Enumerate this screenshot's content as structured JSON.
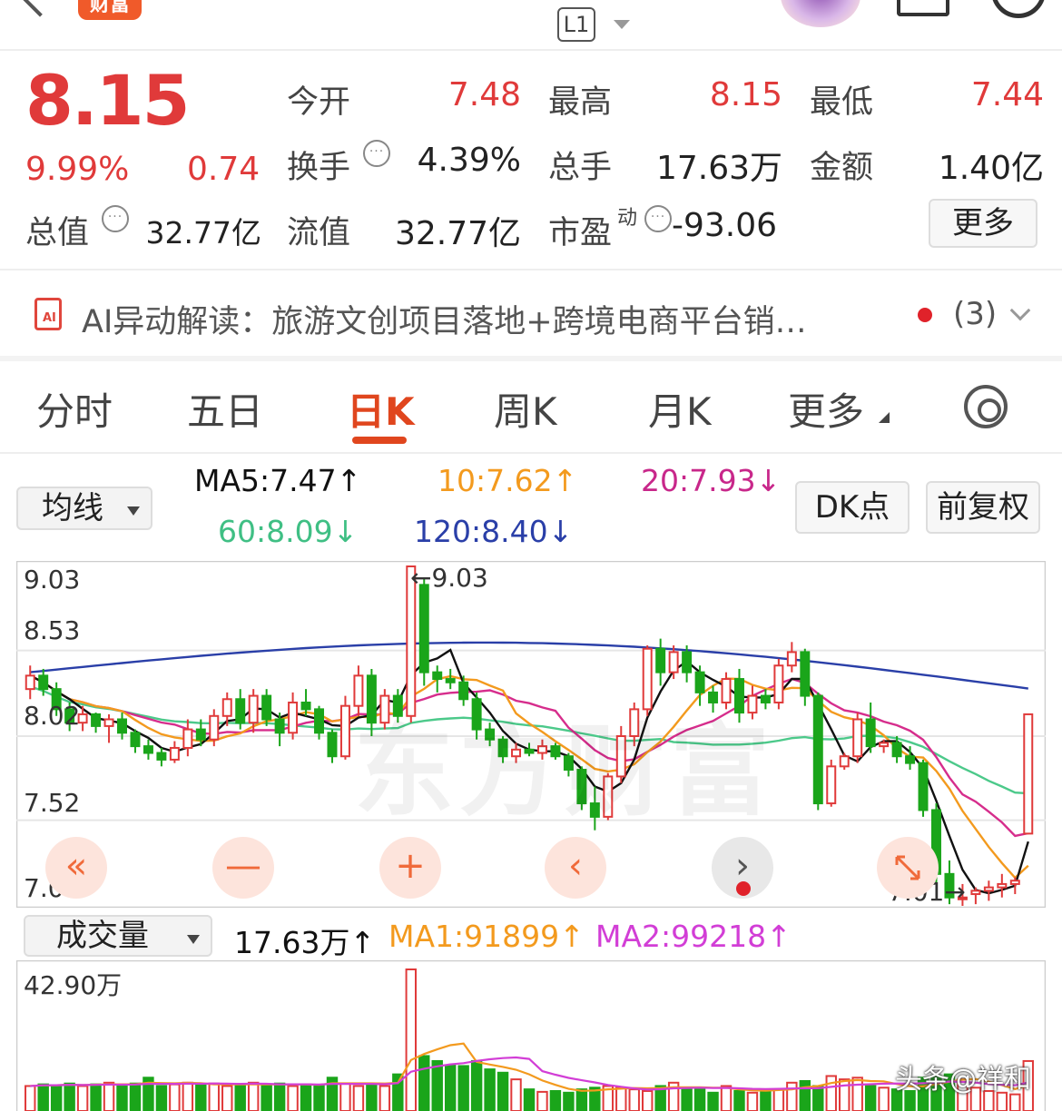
{
  "header": {
    "brand_badge": "财富",
    "level_badge": "L1"
  },
  "quote": {
    "price": "8.15",
    "change_pct": "9.99%",
    "change_amt": "0.74",
    "fields": {
      "open_label": "今开",
      "open_value": "7.48",
      "high_label": "最高",
      "high_value": "8.15",
      "low_label": "最低",
      "low_value": "7.44",
      "turnover_label": "换手",
      "turnover_value": "4.39%",
      "volume_label": "总手",
      "volume_value": "17.63万",
      "amount_label": "金额",
      "amount_value": "1.40亿",
      "mktcap_label": "总值",
      "mktcap_value": "32.77亿",
      "float_label": "流值",
      "float_value": "32.77亿",
      "pe_label": "市盈",
      "pe_sup": "动",
      "pe_value": "-93.06"
    },
    "more_label": "更多",
    "info_glyph": "···"
  },
  "ai_bar": {
    "text": "AI异动解读：旅游文创项目落地+跨境电商平台销…",
    "count": "(3)"
  },
  "tabs": [
    {
      "label": "分时"
    },
    {
      "label": "五日"
    },
    {
      "label": "日K"
    },
    {
      "label": "周K"
    },
    {
      "label": "月K"
    },
    {
      "label": "更多"
    }
  ],
  "ma_bar": {
    "dropdown_label": "均线",
    "ma5": "MA5:7.47↑",
    "ma10": "10:7.62↑",
    "ma20": "20:7.93↓",
    "ma60": "60:8.09↓",
    "ma120": "120:8.40↓",
    "dk_label": "DK点",
    "fq_label": "前复权"
  },
  "kchart": {
    "y_labels": [
      "9.03",
      "8.53",
      "8.02",
      "7.52",
      "7.01"
    ],
    "high_marker": "←9.03",
    "low_marker": "7.01→",
    "watermark": "东方财富",
    "controls": [
      "«",
      "—",
      "+",
      "‹",
      "›"
    ],
    "colors": {
      "up": "#e03a3a",
      "down": "#1aa51a",
      "ma5": "#111111",
      "ma10": "#f39a1e",
      "ma20": "#d62d8c",
      "ma60": "#4cc98a",
      "ma120": "#2a3fa8"
    }
  },
  "volume_bar": {
    "dropdown_label": "成交量",
    "vol": "17.63万↑",
    "ma1": "MA1:91899↑",
    "ma2": "MA2:99218↑"
  },
  "volchart": {
    "y_label": "42.90万",
    "watermark": "头条@祥和"
  },
  "chart_data": {
    "type": "candlestick",
    "ylim": [
      7.01,
      9.03
    ],
    "candles": [
      [
        8.3,
        8.44,
        8.24,
        8.38
      ],
      [
        8.38,
        8.42,
        8.26,
        8.3
      ],
      [
        8.3,
        8.34,
        8.14,
        8.18
      ],
      [
        8.18,
        8.22,
        8.05,
        8.1
      ],
      [
        8.1,
        8.2,
        8.05,
        8.15
      ],
      [
        8.15,
        8.16,
        8.04,
        8.08
      ],
      [
        8.08,
        8.15,
        7.98,
        8.12
      ],
      [
        8.12,
        8.16,
        8.0,
        8.04
      ],
      [
        8.04,
        8.06,
        7.92,
        7.96
      ],
      [
        7.96,
        8.0,
        7.88,
        7.92
      ],
      [
        7.92,
        7.95,
        7.84,
        7.88
      ],
      [
        7.88,
        7.99,
        7.86,
        7.95
      ],
      [
        7.95,
        8.12,
        7.9,
        8.06
      ],
      [
        8.06,
        8.12,
        7.96,
        8.0
      ],
      [
        8.0,
        8.18,
        7.96,
        8.14
      ],
      [
        8.14,
        8.28,
        8.08,
        8.24
      ],
      [
        8.24,
        8.3,
        8.06,
        8.1
      ],
      [
        8.1,
        8.3,
        8.04,
        8.26
      ],
      [
        8.26,
        8.3,
        8.08,
        8.12
      ],
      [
        8.12,
        8.16,
        7.96,
        8.04
      ],
      [
        8.04,
        8.28,
        8.0,
        8.22
      ],
      [
        8.22,
        8.3,
        8.14,
        8.18
      ],
      [
        8.18,
        8.2,
        8.0,
        8.04
      ],
      [
        8.04,
        8.06,
        7.86,
        7.9
      ],
      [
        7.9,
        8.26,
        7.88,
        8.2
      ],
      [
        8.2,
        8.44,
        8.14,
        8.38
      ],
      [
        8.38,
        8.42,
        8.02,
        8.1
      ],
      [
        8.1,
        8.3,
        8.06,
        8.26
      ],
      [
        8.26,
        8.3,
        8.1,
        8.14
      ],
      [
        8.14,
        9.03,
        8.1,
        9.03
      ],
      [
        8.92,
        8.96,
        8.32,
        8.4
      ],
      [
        8.4,
        8.44,
        8.28,
        8.36
      ],
      [
        8.36,
        8.42,
        8.3,
        8.34
      ],
      [
        8.34,
        8.38,
        8.2,
        8.24
      ],
      [
        8.24,
        8.28,
        8.0,
        8.06
      ],
      [
        8.06,
        8.1,
        7.96,
        8.0
      ],
      [
        8.0,
        8.02,
        7.86,
        7.9
      ],
      [
        7.9,
        7.98,
        7.86,
        7.94
      ],
      [
        7.94,
        7.98,
        7.9,
        7.92
      ],
      [
        7.92,
        8.0,
        7.88,
        7.96
      ],
      [
        7.96,
        7.98,
        7.88,
        7.9
      ],
      [
        7.9,
        7.92,
        7.78,
        7.82
      ],
      [
        7.82,
        7.84,
        7.58,
        7.62
      ],
      [
        7.62,
        7.72,
        7.46,
        7.54
      ],
      [
        7.54,
        7.8,
        7.52,
        7.78
      ],
      [
        7.78,
        8.08,
        7.74,
        8.02
      ],
      [
        8.02,
        8.22,
        7.96,
        8.18
      ],
      [
        8.18,
        8.56,
        8.14,
        8.54
      ],
      [
        8.54,
        8.6,
        8.32,
        8.4
      ],
      [
        8.4,
        8.56,
        8.36,
        8.52
      ],
      [
        8.52,
        8.56,
        8.34,
        8.4
      ],
      [
        8.4,
        8.44,
        8.2,
        8.28
      ],
      [
        8.28,
        8.32,
        8.16,
        8.22
      ],
      [
        8.22,
        8.4,
        8.18,
        8.36
      ],
      [
        8.36,
        8.42,
        8.1,
        8.16
      ],
      [
        8.16,
        8.32,
        8.12,
        8.26
      ],
      [
        8.26,
        8.3,
        8.18,
        8.22
      ],
      [
        8.22,
        8.48,
        8.18,
        8.44
      ],
      [
        8.44,
        8.58,
        8.4,
        8.52
      ],
      [
        8.52,
        8.54,
        8.2,
        8.26
      ],
      [
        8.26,
        8.28,
        7.58,
        7.62
      ],
      [
        7.62,
        7.88,
        7.6,
        7.84
      ],
      [
        7.84,
        7.92,
        7.82,
        7.9
      ],
      [
        7.9,
        8.16,
        7.86,
        8.12
      ],
      [
        8.12,
        8.22,
        7.92,
        7.96
      ],
      [
        7.96,
        8.0,
        7.92,
        7.98
      ],
      [
        7.98,
        8.02,
        7.86,
        7.9
      ],
      [
        7.9,
        7.96,
        7.82,
        7.86
      ],
      [
        7.86,
        7.88,
        7.54,
        7.58
      ],
      [
        7.58,
        7.62,
        7.14,
        7.2
      ],
      [
        7.2,
        7.28,
        7.02,
        7.06
      ],
      [
        7.06,
        7.14,
        7.01,
        7.06
      ],
      [
        7.08,
        7.12,
        7.02,
        7.1
      ],
      [
        7.1,
        7.16,
        7.04,
        7.12
      ],
      [
        7.12,
        7.2,
        7.06,
        7.14
      ],
      [
        7.14,
        7.18,
        7.08,
        7.16
      ],
      [
        7.44,
        8.15,
        7.44,
        8.15
      ]
    ],
    "volume_max": "42.90万"
  }
}
